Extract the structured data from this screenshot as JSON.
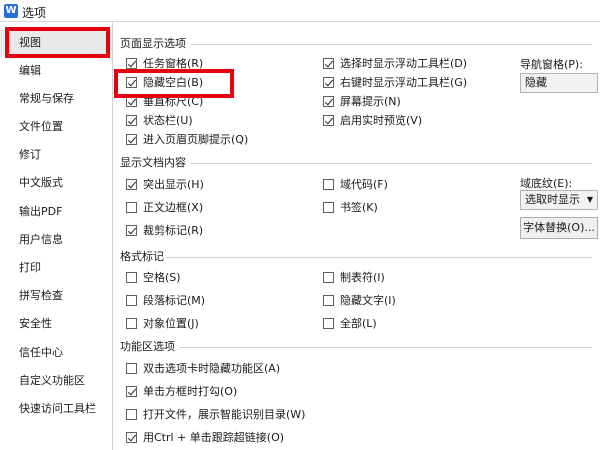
{
  "window": {
    "title": "选项",
    "app_icon": "wps-writer-icon"
  },
  "sidebar": {
    "items": [
      {
        "label": "视图"
      },
      {
        "label": "编辑"
      },
      {
        "label": "常规与保存"
      },
      {
        "label": "文件位置"
      },
      {
        "label": "修订"
      },
      {
        "label": "中文版式"
      },
      {
        "label": "输出PDF"
      },
      {
        "label": "用户信息"
      },
      {
        "label": "打印"
      },
      {
        "label": "拼写检查"
      },
      {
        "label": "安全性"
      },
      {
        "label": "信任中心"
      },
      {
        "label": "自定义功能区"
      },
      {
        "label": "快速访问工具栏"
      }
    ],
    "selected": "视图"
  },
  "sections": {
    "page_display": {
      "title": "页面显示选项",
      "col1": [
        {
          "label": "任务窗格(R)",
          "checked": true
        },
        {
          "label": "隐藏空白(B)",
          "checked": true
        },
        {
          "label": "垂直标尺(C)",
          "checked": true
        },
        {
          "label": "状态栏(U)",
          "checked": true
        },
        {
          "label": "进入页眉页脚提示(Q)",
          "checked": true
        }
      ],
      "col2": [
        {
          "label": "选择时显示浮动工具栏(D)",
          "checked": true
        },
        {
          "label": "右键时显示浮动工具栏(G)",
          "checked": true
        },
        {
          "label": "屏幕提示(N)",
          "checked": true
        },
        {
          "label": "启用实时预览(V)",
          "checked": true
        }
      ],
      "nav_pane_label": "导航窗格(P):",
      "nav_pane_value": "隐藏"
    },
    "doc_content": {
      "title": "显示文档内容",
      "col1": [
        {
          "label": "突出显示(H)",
          "checked": true
        },
        {
          "label": "正文边框(X)",
          "checked": false
        },
        {
          "label": "裁剪标记(R)",
          "checked": true
        }
      ],
      "col2": [
        {
          "label": "域代码(F)",
          "checked": false
        },
        {
          "label": "书签(K)",
          "checked": false
        }
      ],
      "field_shading_label": "域底纹(E):",
      "field_shading_value": "选取时显示",
      "font_sub_button": "字体替换(O)..."
    },
    "format_marks": {
      "title": "格式标记",
      "col1": [
        {
          "label": "空格(S)",
          "checked": false
        },
        {
          "label": "段落标记(M)",
          "checked": false
        },
        {
          "label": "对象位置(J)",
          "checked": false
        }
      ],
      "col2": [
        {
          "label": "制表符(I)",
          "checked": false
        },
        {
          "label": "隐藏文字(I)",
          "checked": false
        },
        {
          "label": "全部(L)",
          "checked": false
        }
      ]
    },
    "ribbon": {
      "title": "功能区选项",
      "items": [
        {
          "label": "双击选项卡时隐藏功能区(A)",
          "checked": false
        },
        {
          "label": "单击方框时打勾(O)",
          "checked": true
        },
        {
          "label": "打开文件，展示智能识别目录(W)",
          "checked": false
        },
        {
          "label": "用Ctrl + 单击跟踪超链接(O)",
          "checked": true
        }
      ]
    }
  },
  "colors": {
    "highlight": "#e4000f",
    "selected_bg": "#e9e9e9",
    "app_icon": "#2b6fd6"
  }
}
